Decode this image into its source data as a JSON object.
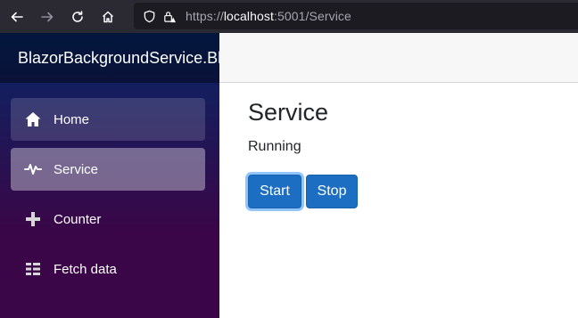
{
  "browser": {
    "url_prefix": "https://",
    "url_host": "localhost",
    "url_rest": ":5001/Service"
  },
  "sidebar": {
    "brand": "BlazorBackgroundService.Blazor",
    "items": [
      {
        "label": "Home",
        "icon": "home-icon"
      },
      {
        "label": "Service",
        "icon": "pulse-icon"
      },
      {
        "label": "Counter",
        "icon": "plus-icon"
      },
      {
        "label": "Fetch data",
        "icon": "list-icon"
      }
    ]
  },
  "main": {
    "title": "Service",
    "status": "Running",
    "start_label": "Start",
    "stop_label": "Stop"
  },
  "colors": {
    "primary_button": "#1b6ec2",
    "sidebar_top": "#052767",
    "sidebar_bottom": "#3a0647"
  }
}
